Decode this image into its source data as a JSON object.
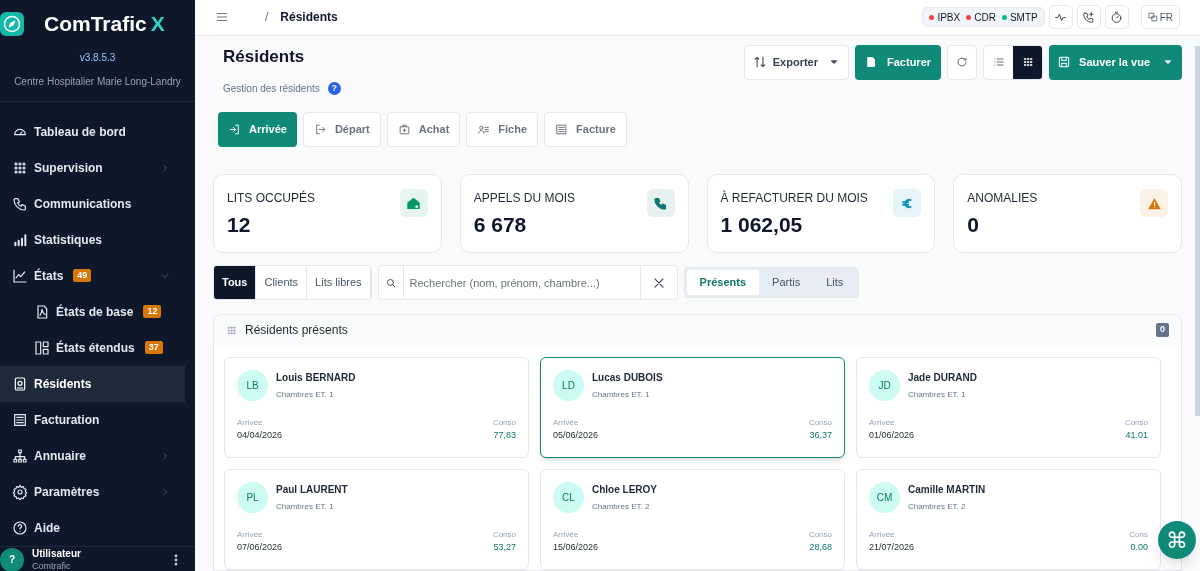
{
  "sidebar": {
    "brand": {
      "name": "ComTrafic",
      "accent": "X"
    },
    "version": "v3.8.5.3",
    "org": "Centre Hospitalier Marie Long-Landry",
    "items": [
      {
        "label": "Tableau de bord",
        "selected": false
      },
      {
        "label": "Supervision",
        "selected": false
      },
      {
        "label": "Communications",
        "selected": false
      },
      {
        "label": "Statistiques",
        "selected": false
      },
      {
        "label": "États",
        "badge": "49",
        "expanded": true,
        "selected": false,
        "children": [
          {
            "label": "États de base",
            "badge": "12",
            "selected": false
          },
          {
            "label": "États étendus",
            "badge": "37",
            "selected": false
          }
        ]
      },
      {
        "label": "Résidents",
        "selected": true
      },
      {
        "label": "Facturation",
        "selected": false
      },
      {
        "label": "Annuaire",
        "selected": false
      },
      {
        "label": "Paramètres",
        "selected": false
      },
      {
        "label": "Aide",
        "selected": false
      }
    ],
    "user": {
      "initial": "?",
      "name": "Utilisateur",
      "org": "Comtrafic"
    }
  },
  "topbar": {
    "separator": "/",
    "page": "Résidents",
    "status": [
      {
        "label": "IPBX",
        "color": "#ef4444"
      },
      {
        "label": "CDR",
        "color": "#ef4444"
      },
      {
        "label": "SMTP",
        "color": "#10b981"
      }
    ],
    "language": "FR"
  },
  "header": {
    "title": "Résidents",
    "subtitle": "Gestion des résidents",
    "help": "?",
    "export": {
      "label": "Exporter"
    },
    "bill": {
      "label": "Facturer"
    },
    "views": [
      {
        "kind": "list",
        "selected": false
      },
      {
        "kind": "grid",
        "selected": true
      }
    ],
    "save": {
      "label": "Sauver la vue"
    }
  },
  "actions": [
    {
      "label": "Arrivée",
      "primary": true
    },
    {
      "label": "Départ",
      "primary": false
    },
    {
      "label": "Achat",
      "primary": false
    },
    {
      "label": "Fiche",
      "primary": false
    },
    {
      "label": "Facture",
      "primary": false
    }
  ],
  "stats": [
    {
      "label": "LITS OCCUPÉS",
      "value": "12",
      "color": "#059669"
    },
    {
      "label": "APPELS DU MOIS",
      "value": "6 678",
      "color": "#0f766e"
    },
    {
      "label": "À REFACTURER DU MOIS",
      "value": "1 062,05",
      "color": "#0891b2"
    },
    {
      "label": "ANOMALIES",
      "value": "0",
      "color": "#d97706"
    }
  ],
  "filters": {
    "segments": [
      {
        "label": "Tous",
        "selected": true
      },
      {
        "label": "Clients",
        "selected": false
      },
      {
        "label": "Lits libres",
        "selected": false
      }
    ],
    "search": {
      "placeholder": "Rechercher (nom, prénom, chambre...)"
    },
    "tabs": [
      {
        "label": "Présents",
        "selected": true
      },
      {
        "label": "Partis",
        "selected": false
      },
      {
        "label": "Lits",
        "selected": false
      }
    ]
  },
  "panel": {
    "title": "Résidents présents",
    "count": "0",
    "residents": [
      {
        "initials": "LB",
        "name": "Louis BERNARD",
        "room": "Chambres ET. 1",
        "arrival_label": "Arrivée",
        "arrival": "04/04/2026",
        "conso_label": "Conso",
        "conso": "77,83",
        "selected": false
      },
      {
        "initials": "LD",
        "name": "Lucas DUBOIS",
        "room": "Chambres ET. 1",
        "arrival_label": "Arrivée",
        "arrival": "05/06/2026",
        "conso_label": "Conso",
        "conso": "36,37",
        "selected": true
      },
      {
        "initials": "JD",
        "name": "Jade DURAND",
        "room": "Chambres ET. 1",
        "arrival_label": "Arrivée",
        "arrival": "01/06/2026",
        "conso_label": "Conso",
        "conso": "41.01",
        "selected": false
      },
      {
        "initials": "PL",
        "name": "Paul LAURENT",
        "room": "Chambres ET. 1",
        "arrival_label": "Arrivée",
        "arrival": "07/06/2026",
        "conso_label": "Conso",
        "conso": "53,27",
        "selected": false
      },
      {
        "initials": "CL",
        "name": "Chloe LEROY",
        "room": "Chambres ET. 2",
        "arrival_label": "Arrivée",
        "arrival": "15/06/2026",
        "conso_label": "Conso",
        "conso": "28,68",
        "selected": false
      },
      {
        "initials": "CM",
        "name": "Camille MARTIN",
        "room": "Chambres ET. 2",
        "arrival_label": "Arrivée",
        "arrival": "21/07/2026",
        "conso_label": "Cons",
        "conso": "0.00",
        "selected": false
      }
    ]
  },
  "fab": {
    "label": "⌘"
  }
}
